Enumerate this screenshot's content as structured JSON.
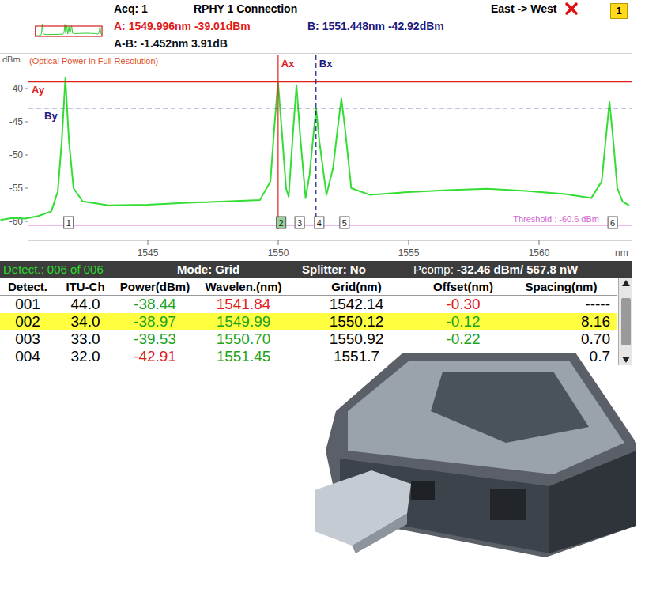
{
  "header": {
    "acquisition": "Acq: 1",
    "title": "RPHY 1 Connection",
    "direction": "East -> West",
    "pass": false,
    "page": "1"
  },
  "markers": {
    "a_readout": "A: 1549.996nm -39.01dBm",
    "b_readout": "B: 1551.448nm -42.92dBm",
    "delta_readout": "A-B: -1.452nm 3.91dB",
    "ay_label": "Ay",
    "by_label": "By",
    "ax_label": "Ax",
    "bx_label": "Bx",
    "a_nm": 1549.996,
    "a_dbm": -39.01,
    "b_nm": 1551.448,
    "b_dbm": -42.92
  },
  "chart": {
    "y_unit": "dBm",
    "subtitle": "(Optical Power in Full Resolution)",
    "y_ticks": [
      {
        "label": "-40",
        "value": -40
      },
      {
        "label": "-45",
        "value": -45
      },
      {
        "label": "-50",
        "value": -50
      },
      {
        "label": "-55",
        "value": -55
      },
      {
        "label": "-60",
        "value": -60
      }
    ],
    "x_ticks": [
      {
        "label": "1545",
        "value": 1545
      },
      {
        "label": "1550",
        "value": 1550
      },
      {
        "label": "1555",
        "value": 1555
      },
      {
        "label": "1560",
        "value": 1560
      }
    ],
    "x_unit": "nm",
    "threshold": {
      "label": "Threshold : -60.6 dBm",
      "value": -60.6
    },
    "series": {
      "wavelengths": [
        1539.35,
        1539.8,
        1540.3,
        1540.8,
        1541.3,
        1541.55,
        1541.7,
        1541.84,
        1541.98,
        1542.15,
        1542.5,
        1543.5,
        1545,
        1546.5,
        1548,
        1549.3,
        1549.7,
        1549.85,
        1549.99,
        1550.13,
        1550.3,
        1550.4,
        1550.56,
        1550.7,
        1550.84,
        1551.05,
        1551.2,
        1551.35,
        1551.45,
        1551.58,
        1551.85,
        1552.1,
        1552.28,
        1552.42,
        1552.56,
        1552.8,
        1553.5,
        1555,
        1556.5,
        1558,
        1559.5,
        1561,
        1562,
        1562.4,
        1562.55,
        1562.7,
        1562.85,
        1563.0,
        1563.2,
        1563.45
      ],
      "powers": [
        -59.8,
        -59.5,
        -59.6,
        -59.2,
        -58.5,
        -55.5,
        -48,
        -38.4,
        -48,
        -55,
        -57.0,
        -57.6,
        -57.5,
        -57.2,
        -57.0,
        -56.8,
        -54,
        -46,
        -39.0,
        -46,
        -55,
        -56.3,
        -47,
        -39.5,
        -47,
        -56.5,
        -53,
        -47,
        -43.0,
        -48,
        -56,
        -52,
        -46,
        -41.5,
        -46,
        -55,
        -56.0,
        -55.6,
        -55.3,
        -55.1,
        -55.4,
        -55.9,
        -56.5,
        -54,
        -48,
        -42.0,
        -48,
        -55,
        -57,
        -57.6
      ]
    },
    "peaks": [
      {
        "label": "1",
        "nm": 1541.84,
        "selected": false
      },
      {
        "label": "2",
        "nm": 1549.99,
        "selected": true
      },
      {
        "label": "3",
        "nm": 1550.7,
        "selected": false
      },
      {
        "label": "4",
        "nm": 1551.45,
        "selected": false
      },
      {
        "label": "5",
        "nm": 1552.42,
        "selected": false
      },
      {
        "label": "6",
        "nm": 1562.7,
        "selected": false
      }
    ]
  },
  "status_bar": {
    "detect": "Detect.: 006 of 006",
    "mode": "Mode: Grid",
    "splitter": "Splitter: No",
    "pcomp_label": "Pcomp:",
    "pcomp_value": "-32.46 dBm/ 567.8 nW"
  },
  "table": {
    "columns": [
      "Detect.",
      "ITU-Ch",
      "Power(dBm)",
      "Wavelen.(nm)",
      "Grid(nm)",
      "Offset(nm)",
      "Spacing(nm)"
    ],
    "rows": [
      {
        "detect": "001",
        "itu_ch": "44.0",
        "power": {
          "text": "-38.44",
          "color": "#1ea31e"
        },
        "wavelength": {
          "text": "1541.84",
          "color": "#e01b1b"
        },
        "grid": "1542.14",
        "offset": {
          "text": "-0.30",
          "color": "#e01b1b"
        },
        "spacing": "-----",
        "selected": false
      },
      {
        "detect": "002",
        "itu_ch": "34.0",
        "power": {
          "text": "-38.97",
          "color": "#1ea31e"
        },
        "wavelength": {
          "text": "1549.99",
          "color": "#1ea31e"
        },
        "grid": "1550.12",
        "offset": {
          "text": "-0.12",
          "color": "#1ea31e"
        },
        "spacing": "8.16",
        "selected": true
      },
      {
        "detect": "003",
        "itu_ch": "33.0",
        "power": {
          "text": "-39.53",
          "color": "#1ea31e"
        },
        "wavelength": {
          "text": "1550.70",
          "color": "#1ea31e"
        },
        "grid": "1550.92",
        "offset": {
          "text": "-0.22",
          "color": "#1ea31e"
        },
        "spacing": "0.70",
        "selected": false
      },
      {
        "detect": "004",
        "itu_ch": "32.0",
        "power": {
          "text": "-42.91",
          "color": "#e01b1b"
        },
        "wavelength": {
          "text": "1551.45",
          "color": "#1ea31e"
        },
        "grid": "1551.7",
        "offset": null,
        "spacing": "0.7",
        "selected": false
      }
    ]
  }
}
